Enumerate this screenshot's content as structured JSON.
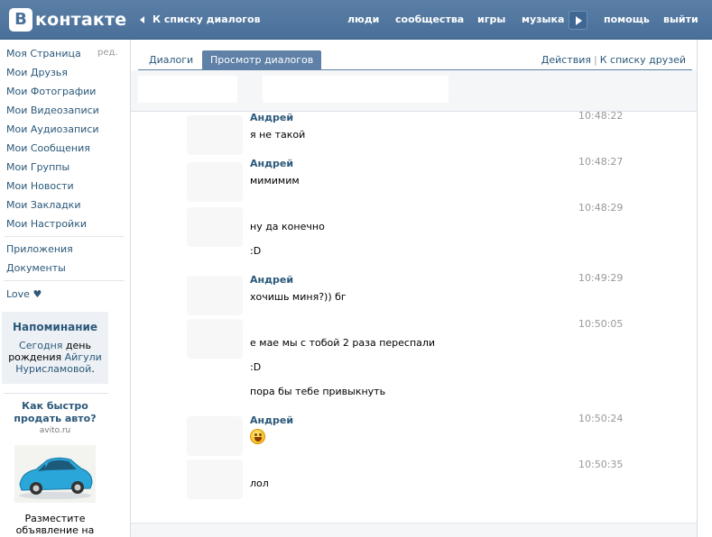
{
  "header": {
    "logo_letter": "В",
    "logo_text": "контакте",
    "back_link": "К списку диалогов",
    "nav": [
      "люди",
      "сообщества",
      "игры",
      "музыка",
      "помощь",
      "выйти"
    ],
    "brand_color": "#49709a"
  },
  "sidebar": {
    "items": [
      "Моя Страница",
      "Мои Друзья",
      "Мои Фотографии",
      "Мои Видеозаписи",
      "Мои Аудиозаписи",
      "Мои Сообщения",
      "Мои Группы",
      "Мои Новости",
      "Мои Закладки",
      "Мои Настройки"
    ],
    "edit_label": "ред.",
    "apps": [
      "Приложения",
      "Документы"
    ],
    "love": "Love",
    "heart_icon": "heart-icon"
  },
  "reminder": {
    "title": "Напоминание",
    "today": "Сегодня",
    "day": "день",
    "birthday": "рождения",
    "name_first": "Айгули",
    "name_last": "Нурисламовой"
  },
  "ad": {
    "title": "Как быстро продать авто?",
    "domain": "avito.ru",
    "text": "Разместите объявление на AVITO"
  },
  "tabs": {
    "dialogs": "Диалоги",
    "view": "Просмотр диалогов",
    "actions": "Действия",
    "separator": "|",
    "friends": "К списку друзей"
  },
  "messages": [
    {
      "author": "Андрей",
      "time": "10:48:22",
      "text": "я не такой"
    },
    {
      "author": "Андрей",
      "time": "10:48:27",
      "text": "мимимим"
    },
    {
      "author": "",
      "time": "10:48:29",
      "text": "ну да конечно"
    },
    {
      "author": "",
      "time": "",
      "text": ":D"
    },
    {
      "author": "Андрей",
      "time": "10:49:29",
      "text": "хочишь миня?)) бг"
    },
    {
      "author": "",
      "time": "10:50:05",
      "text": "е мае мы с тобой 2 раза переспали"
    },
    {
      "author": "",
      "time": "",
      "text": ":D"
    },
    {
      "author": "",
      "time": "",
      "text": "пора бы тебе привыкнуть"
    },
    {
      "author": "Андрей",
      "time": "10:50:24",
      "text": ""
    },
    {
      "author": "",
      "time": "10:50:35",
      "text": "лол"
    }
  ],
  "emoji": "laughing-smiley-icon"
}
